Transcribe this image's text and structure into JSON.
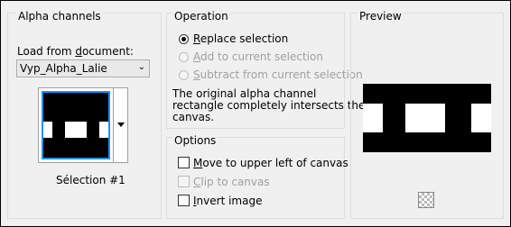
{
  "alpha": {
    "group_title": "Alpha channels",
    "load_label_pre": "Load from ",
    "load_label_u": "d",
    "load_label_post": "ocument:",
    "document_value": "Vyp_Alpha_Lalie",
    "selection_name": "Sélection #1"
  },
  "operation": {
    "group_title": "Operation",
    "replace_u": "R",
    "replace_rest": "eplace selection",
    "add_u": "A",
    "add_rest": "dd to current selection",
    "subtract_u": "S",
    "subtract_rest": "ubtract from current selection",
    "selected": "replace",
    "message_line1": "The original alpha channel",
    "message_line2": "rectangle completely intersects the",
    "message_line3": "canvas."
  },
  "options": {
    "group_title": "Options",
    "move_u": "M",
    "move_rest": "ove to upper left of canvas",
    "clip_u": "C",
    "clip_rest": "lip to canvas",
    "invert_u": "I",
    "invert_rest": "nvert image",
    "move_checked": false,
    "clip_checked": false,
    "invert_checked": false
  },
  "preview": {
    "group_title": "Preview",
    "background_icon": "transparency-checker-icon"
  }
}
